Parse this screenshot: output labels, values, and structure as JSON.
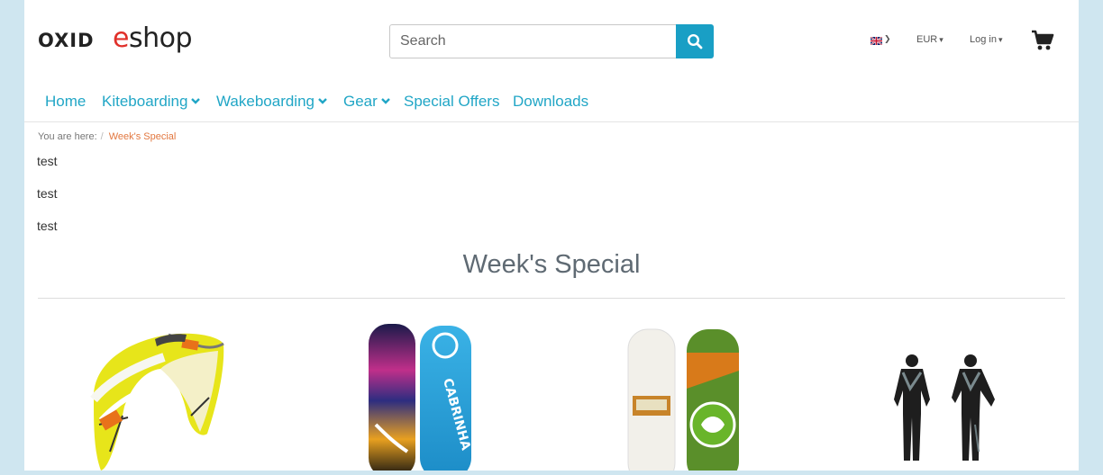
{
  "header": {
    "logo": {
      "part1": "OXID",
      "part2_accent": "e",
      "part2_rest": "shop"
    },
    "search": {
      "placeholder": "Search"
    },
    "currency": "EUR",
    "login": "Log in"
  },
  "nav": {
    "items": [
      {
        "label": "Home"
      },
      {
        "label": "Kiteboarding"
      },
      {
        "label": "Wakeboarding"
      },
      {
        "label": "Gear"
      },
      {
        "label": "Special Offers"
      },
      {
        "label": "Downloads"
      }
    ]
  },
  "breadcrumb": {
    "prefix": "You are here:",
    "separator": "/",
    "current": "Week's Special"
  },
  "content": {
    "lines": [
      "test",
      "test",
      "test"
    ],
    "title": "Week's Special"
  },
  "colors": {
    "accent": "#199fc5",
    "nav_link": "#21a6c6",
    "breadcrumb_current": "#e2773f",
    "logo_e": "#e0302a"
  },
  "icons": {
    "search": "search-icon",
    "flag": "uk-flag-icon",
    "cart": "shopping-cart-icon"
  }
}
